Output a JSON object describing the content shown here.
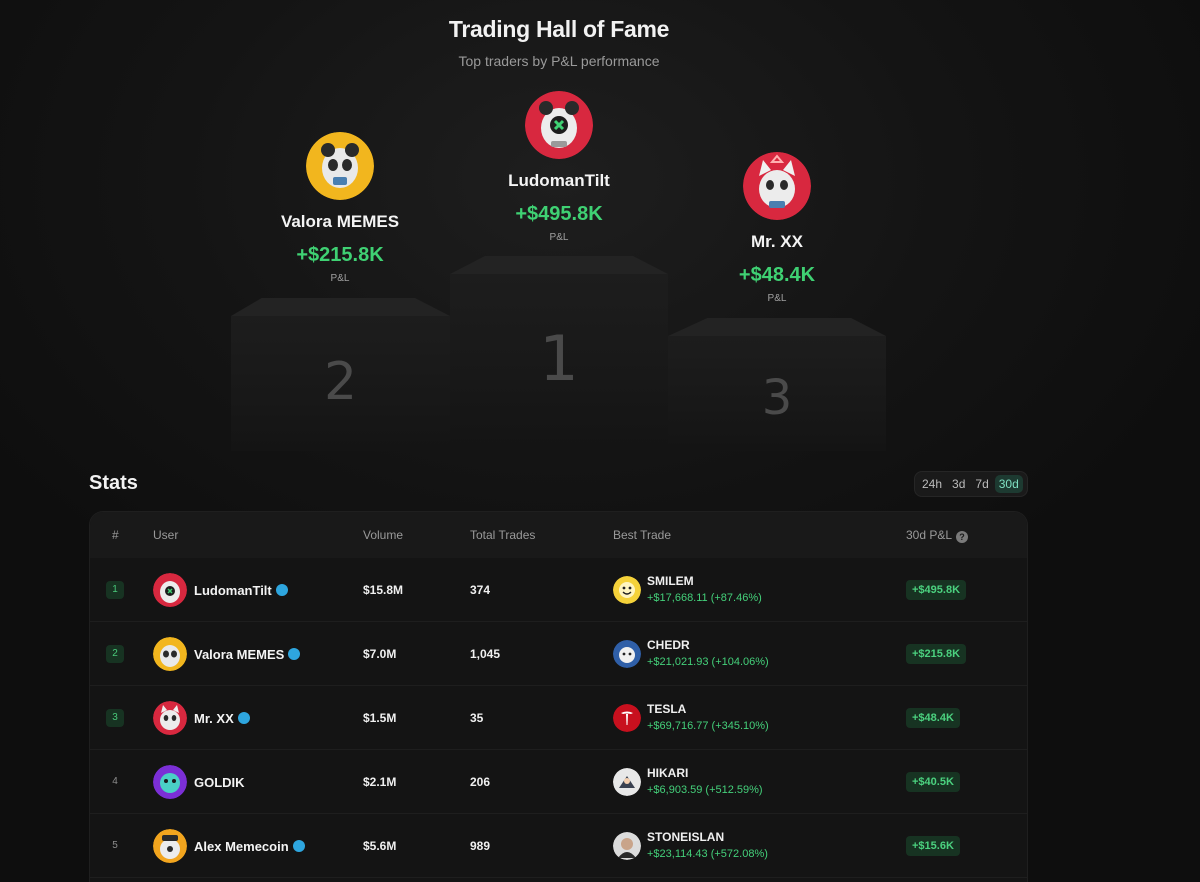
{
  "header": {
    "title": "Trading Hall of Fame",
    "subtitle": "Top traders by P&L performance"
  },
  "podium": {
    "first": {
      "name": "LudomanTilt",
      "pnl": "+$495.8K",
      "pnl_label": "P&L",
      "place": "1"
    },
    "second": {
      "name": "Valora MEMES",
      "pnl": "+$215.8K",
      "pnl_label": "P&L",
      "place": "2"
    },
    "third": {
      "name": "Mr. XX",
      "pnl": "+$48.4K",
      "pnl_label": "P&L",
      "place": "3"
    }
  },
  "stats": {
    "title": "Stats",
    "ranges": [
      "24h",
      "3d",
      "7d",
      "30d"
    ],
    "active_range": "30d",
    "columns": {
      "rank": "#",
      "user": "User",
      "volume": "Volume",
      "trades": "Total Trades",
      "best_trade": "Best Trade",
      "pnl": "30d P&L"
    },
    "rows": [
      {
        "rank": "1",
        "user": "LudomanTilt",
        "verified": true,
        "volume": "$15.8M",
        "trades": "374",
        "best_token": "SMILEM",
        "best_value": "+$17,668.11 (+87.46%)",
        "pnl": "+$495.8K"
      },
      {
        "rank": "2",
        "user": "Valora MEMES",
        "verified": true,
        "volume": "$7.0M",
        "trades": "1,045",
        "best_token": "CHEDR",
        "best_value": "+$21,021.93 (+104.06%)",
        "pnl": "+$215.8K"
      },
      {
        "rank": "3",
        "user": "Mr. XX",
        "verified": true,
        "volume": "$1.5M",
        "trades": "35",
        "best_token": "TESLA",
        "best_value": "+$69,716.77 (+345.10%)",
        "pnl": "+$48.4K"
      },
      {
        "rank": "4",
        "user": "GOLDIK",
        "verified": false,
        "volume": "$2.1M",
        "trades": "206",
        "best_token": "HIKARI",
        "best_value": "+$6,903.59 (+512.59%)",
        "pnl": "+$40.5K"
      },
      {
        "rank": "5",
        "user": "Alex Memecoin",
        "verified": true,
        "volume": "$5.6M",
        "trades": "989",
        "best_token": "STONEISLAN",
        "best_value": "+$23,114.43 (+572.08%)",
        "pnl": "+$15.6K"
      }
    ]
  },
  "colors": {
    "positive": "#3fd173",
    "badge_bg": "#173322",
    "telegram": "#2ea6df"
  }
}
